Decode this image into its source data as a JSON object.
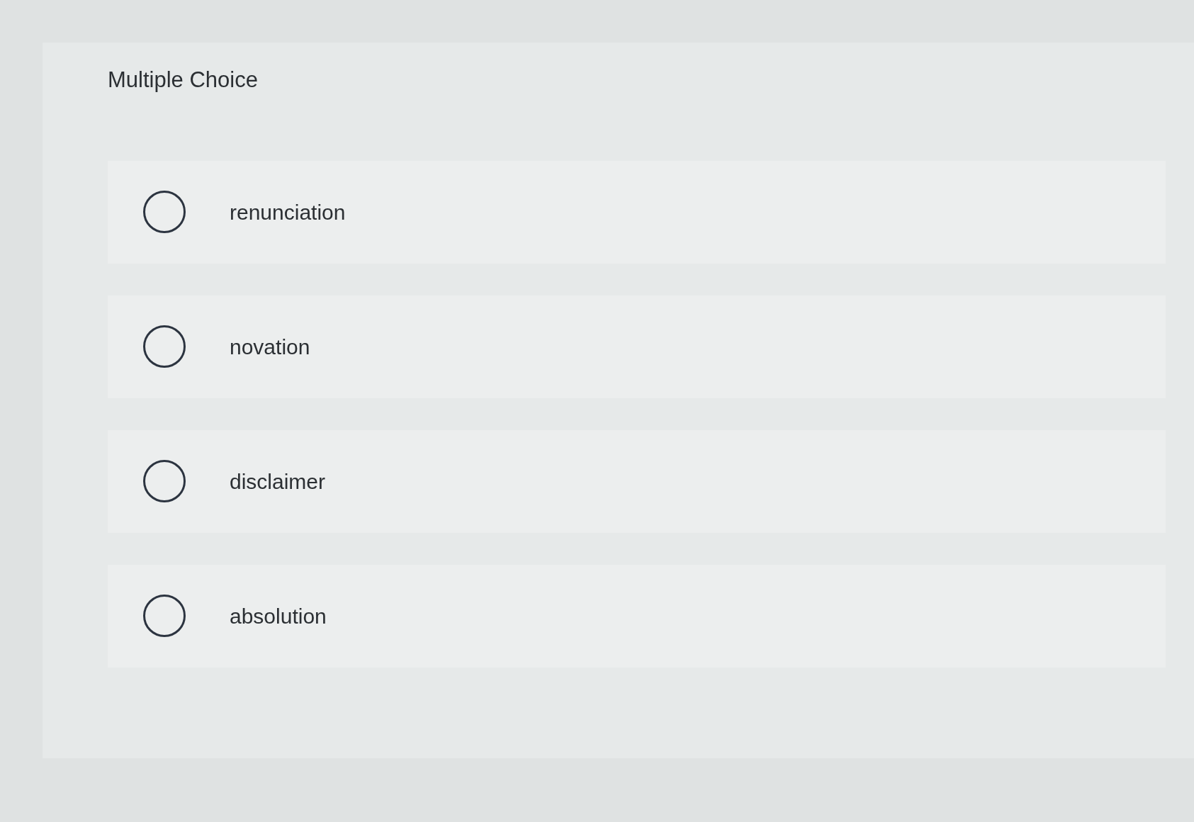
{
  "title": "Multiple Choice",
  "options": [
    {
      "label": "renunciation",
      "selected": false
    },
    {
      "label": "novation",
      "selected": false
    },
    {
      "label": "disclaimer",
      "selected": false
    },
    {
      "label": "absolution",
      "selected": false
    }
  ]
}
